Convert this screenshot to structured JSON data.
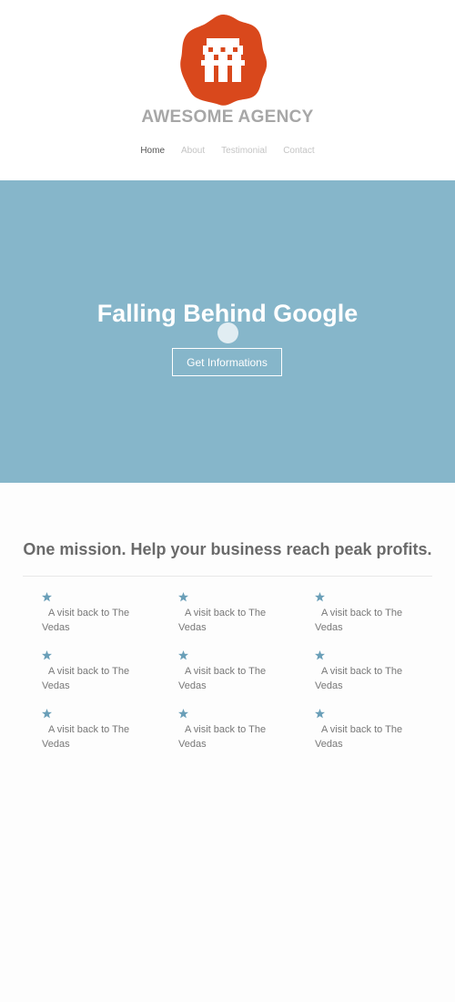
{
  "brand": {
    "logo_icon": "pixel-building-hexagon-logo",
    "logo_color": "#d9481c",
    "name": "AWESOME AGENCY"
  },
  "nav": {
    "items": [
      {
        "label": "Home",
        "active": true
      },
      {
        "label": "About",
        "active": false
      },
      {
        "label": "Testimonial",
        "active": false
      },
      {
        "label": "Contact",
        "active": false
      }
    ]
  },
  "hero": {
    "background": "#86b6ca",
    "title": "Falling Behind Google",
    "button_label": "Get Informations"
  },
  "mission": {
    "title": "One mission. Help your business reach peak profits.",
    "features": [
      {
        "icon": "star-icon",
        "text": "A visit back to The Vedas"
      },
      {
        "icon": "star-icon",
        "text": "A visit back to The Vedas"
      },
      {
        "icon": "star-icon",
        "text": "A visit back to The Vedas"
      },
      {
        "icon": "star-icon",
        "text": "A visit back to The Vedas"
      },
      {
        "icon": "star-icon",
        "text": "A visit back to The Vedas"
      },
      {
        "icon": "star-icon",
        "text": "A visit back to The Vedas"
      },
      {
        "icon": "star-icon",
        "text": "A visit back to The Vedas"
      },
      {
        "icon": "star-icon",
        "text": "A visit back to The Vedas"
      },
      {
        "icon": "star-icon",
        "text": "A visit back to The Vedas"
      }
    ],
    "star_color": "#6a9fb8"
  }
}
